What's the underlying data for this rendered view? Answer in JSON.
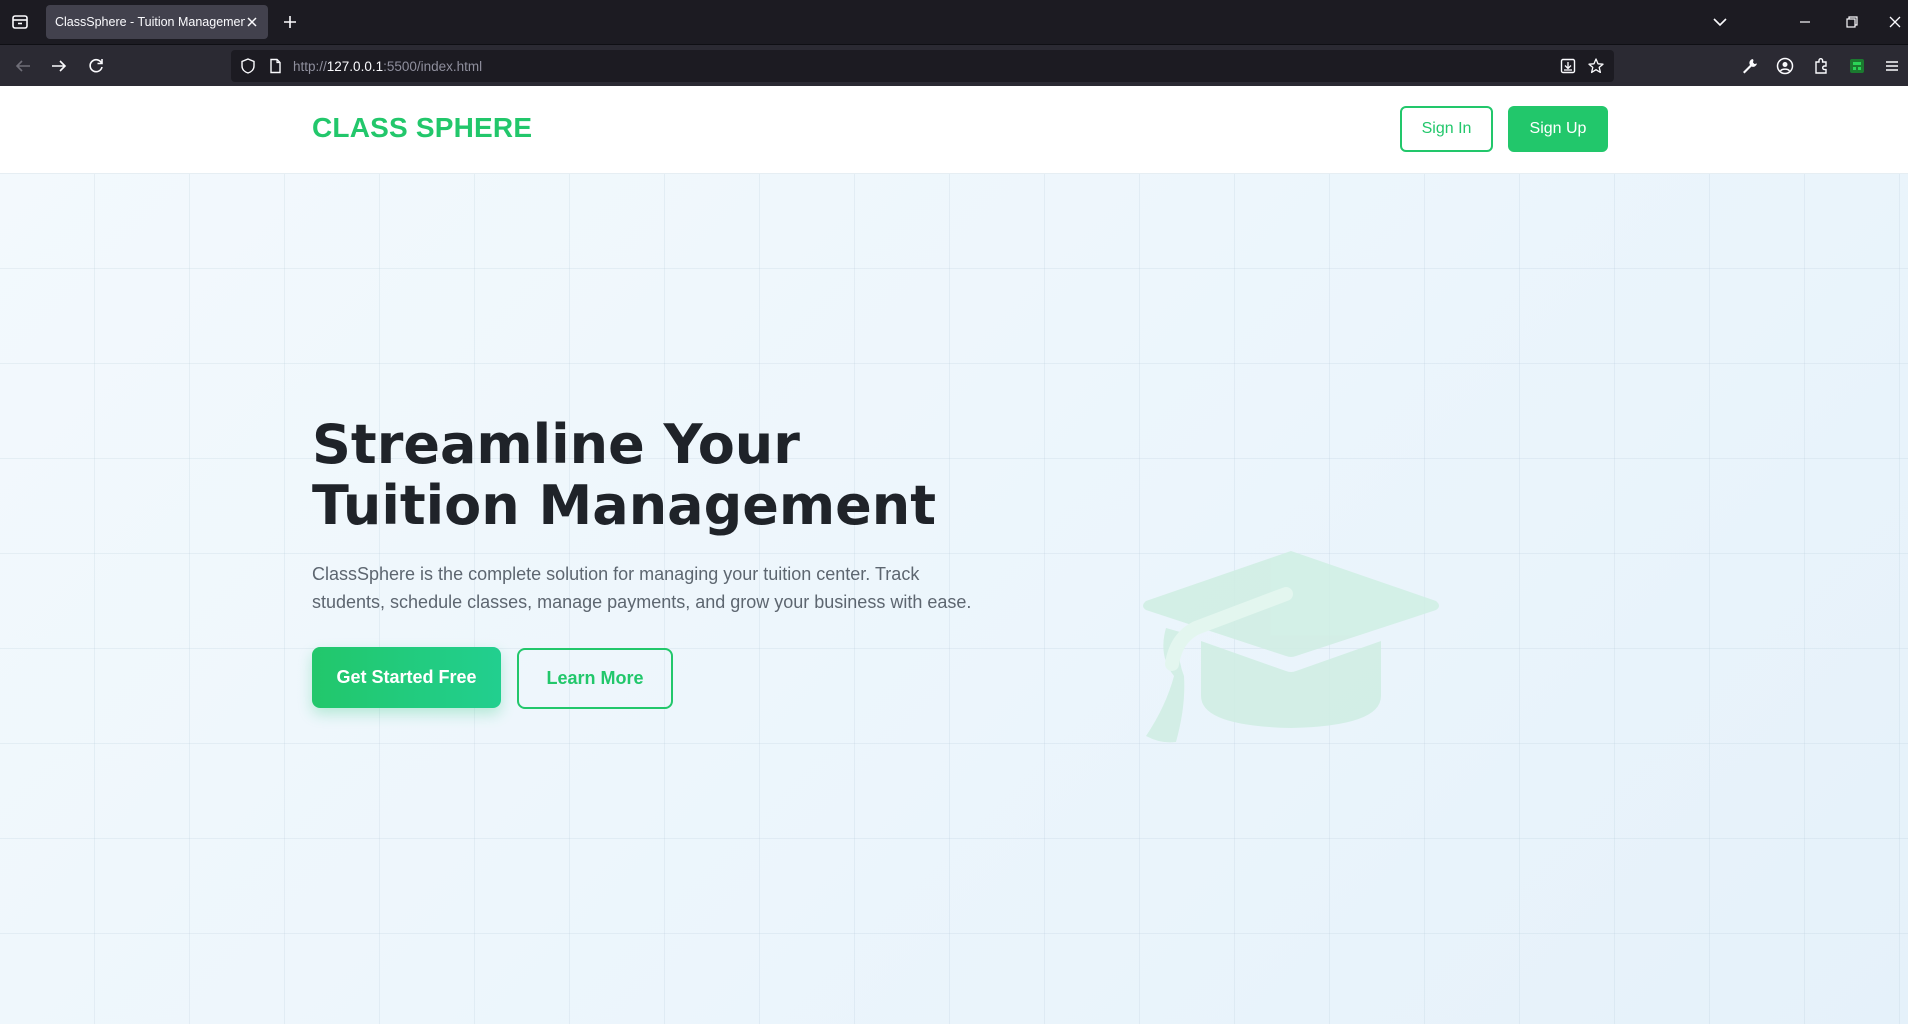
{
  "browser": {
    "tab_title": "ClassSphere - Tuition Management",
    "url_scheme": "http://",
    "url_host": "127.0.0.1",
    "url_rest": ":5500/index.html"
  },
  "header": {
    "brand": "CLASS SPHERE",
    "signin_label": "Sign In",
    "signup_label": "Sign Up"
  },
  "hero": {
    "title_line1": "Streamline Your",
    "title_line2": "Tuition Management",
    "description": "ClassSphere is the complete solution for managing your tuition center. Track students, schedule classes, manage payments, and grow your business with ease.",
    "primary_cta": "Get Started Free",
    "secondary_cta": "Learn More",
    "illustration_icon": "graduation-cap-icon"
  },
  "colors": {
    "brand_green": "#22c76b",
    "heading": "#1f2329",
    "body_text": "#5d6670"
  }
}
